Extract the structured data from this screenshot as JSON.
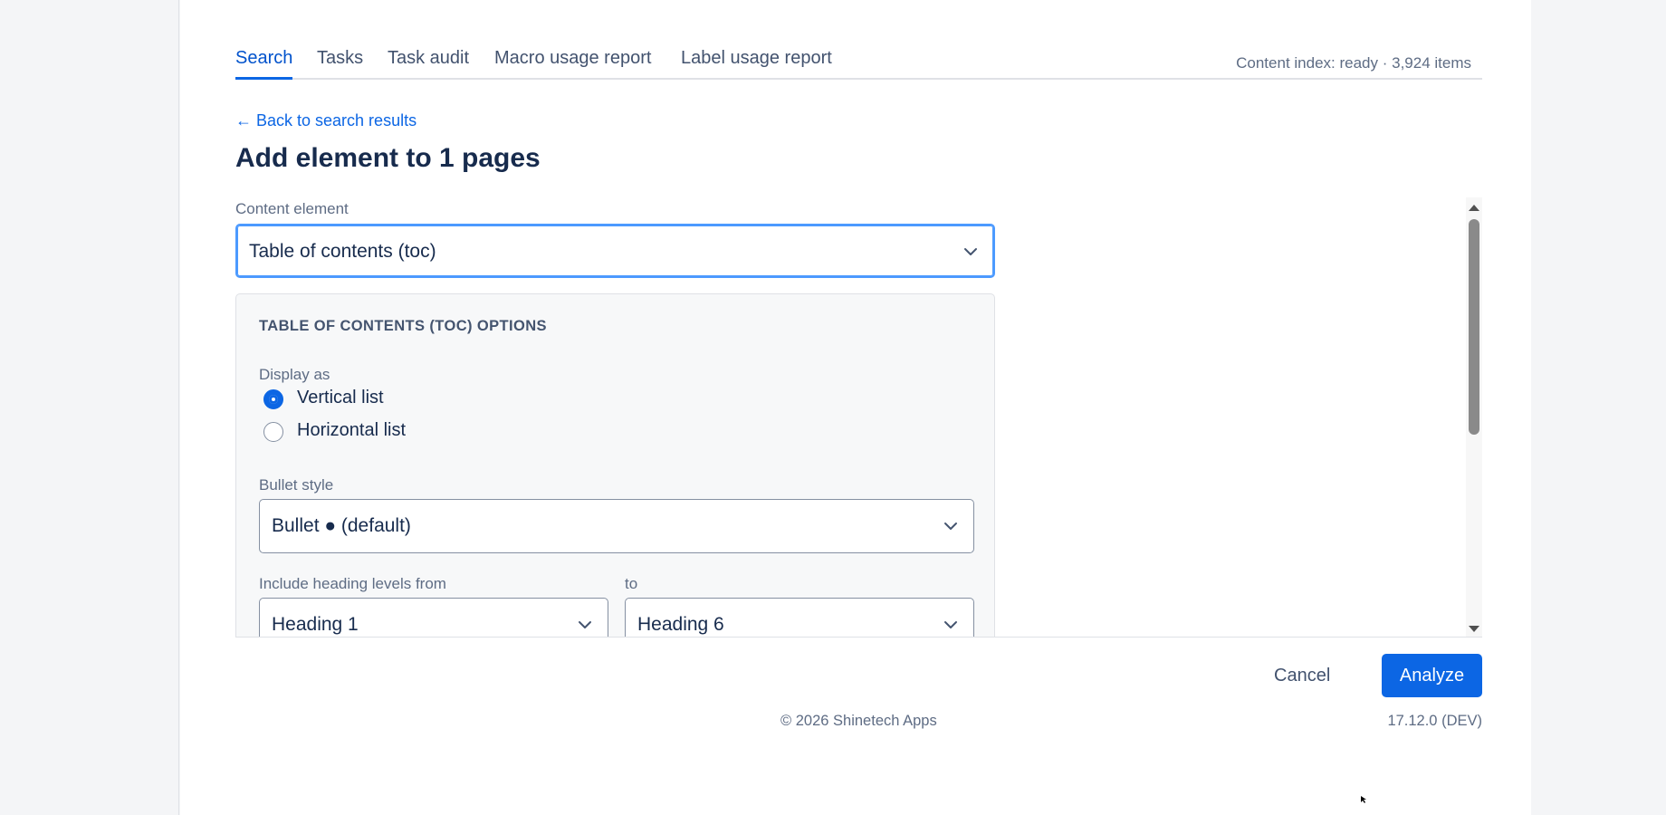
{
  "tabs": [
    {
      "label": "Search",
      "active": true
    },
    {
      "label": "Tasks",
      "active": false
    },
    {
      "label": "Task audit",
      "active": false
    },
    {
      "label": "Macro usage report",
      "active": false
    },
    {
      "label": "Label usage report",
      "active": false
    }
  ],
  "index_status": "Content index: ready · 3,924 items",
  "back_link": "← Back to search results",
  "page_title": "Add element to 1 pages",
  "content_element": {
    "label": "Content element",
    "value": "Table of contents (toc)"
  },
  "options": {
    "heading": "TABLE OF CONTENTS (TOC) OPTIONS",
    "display_as": {
      "label": "Display as",
      "options": [
        {
          "label": "Vertical list",
          "checked": true
        },
        {
          "label": "Horizontal list",
          "checked": false
        }
      ]
    },
    "bullet_style": {
      "label": "Bullet style",
      "value": "Bullet ● (default)"
    },
    "heading_from": {
      "label": "Include heading levels from",
      "value": "Heading 1"
    },
    "heading_to": {
      "label": "to",
      "value": "Heading 6"
    }
  },
  "footer": {
    "cancel_label": "Cancel",
    "analyze_label": "Analyze",
    "copyright": "© 2026 Shinetech Apps",
    "version": "17.12.0 (DEV)"
  },
  "colors": {
    "accent": "#0c66e4",
    "link": "#0c66e4",
    "text": "#172b4d",
    "muted": "#5e6c84"
  }
}
